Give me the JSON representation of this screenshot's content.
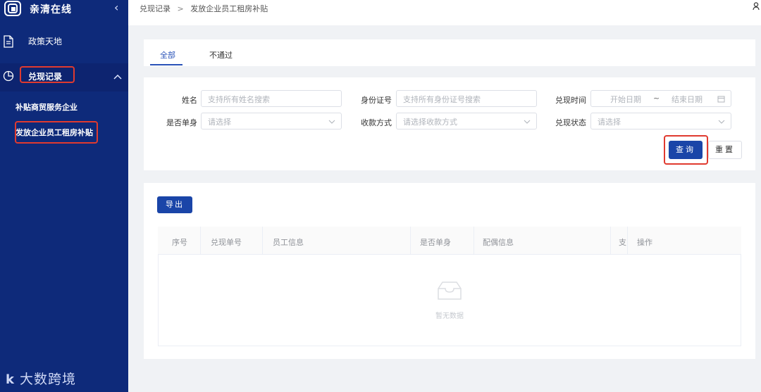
{
  "app": {
    "title": "亲清在线"
  },
  "sidebar": {
    "items": [
      {
        "label": "政策天地",
        "icon": "document-icon"
      },
      {
        "label": "兑现记录",
        "icon": "clock-pie-icon",
        "expanded": true
      }
    ],
    "sub_items": [
      {
        "label": "补贴商贸服务企业"
      },
      {
        "label": "发放企业员工租房补贴",
        "active": true
      }
    ],
    "footer": {
      "logo_mark": "k",
      "logo_text": "大数跨境"
    }
  },
  "breadcrumb": {
    "parent": "兑现记录",
    "separator": ">",
    "current": "发放企业员工租房补贴"
  },
  "tabs": [
    {
      "label": "全部",
      "active": true
    },
    {
      "label": "不通过"
    }
  ],
  "filters": {
    "name": {
      "label": "姓名",
      "placeholder": "支持所有姓名搜索"
    },
    "id_number": {
      "label": "身份证号",
      "placeholder": "支持所有身份证号搜索"
    },
    "redeem_time": {
      "label": "兑现时间",
      "start_placeholder": "开始日期",
      "separator": "~",
      "end_placeholder": "结束日期"
    },
    "is_single": {
      "label": "是否单身",
      "placeholder": "请选择"
    },
    "payment_method": {
      "label": "收款方式",
      "placeholder": "请选择收款方式"
    },
    "redeem_status": {
      "label": "兑现状态",
      "placeholder": "请选择"
    }
  },
  "actions": {
    "query": "查询",
    "reset": "重置",
    "export": "导出"
  },
  "table": {
    "columns": [
      "序号",
      "兑现单号",
      "员工信息",
      "是否单身",
      "配偶信息",
      "支",
      "操作"
    ],
    "empty_text": "暂无数据"
  },
  "colors": {
    "sidebar_bg": "#0e2a7a",
    "primary": "#1a45a8",
    "highlight": "#e03a2f"
  }
}
